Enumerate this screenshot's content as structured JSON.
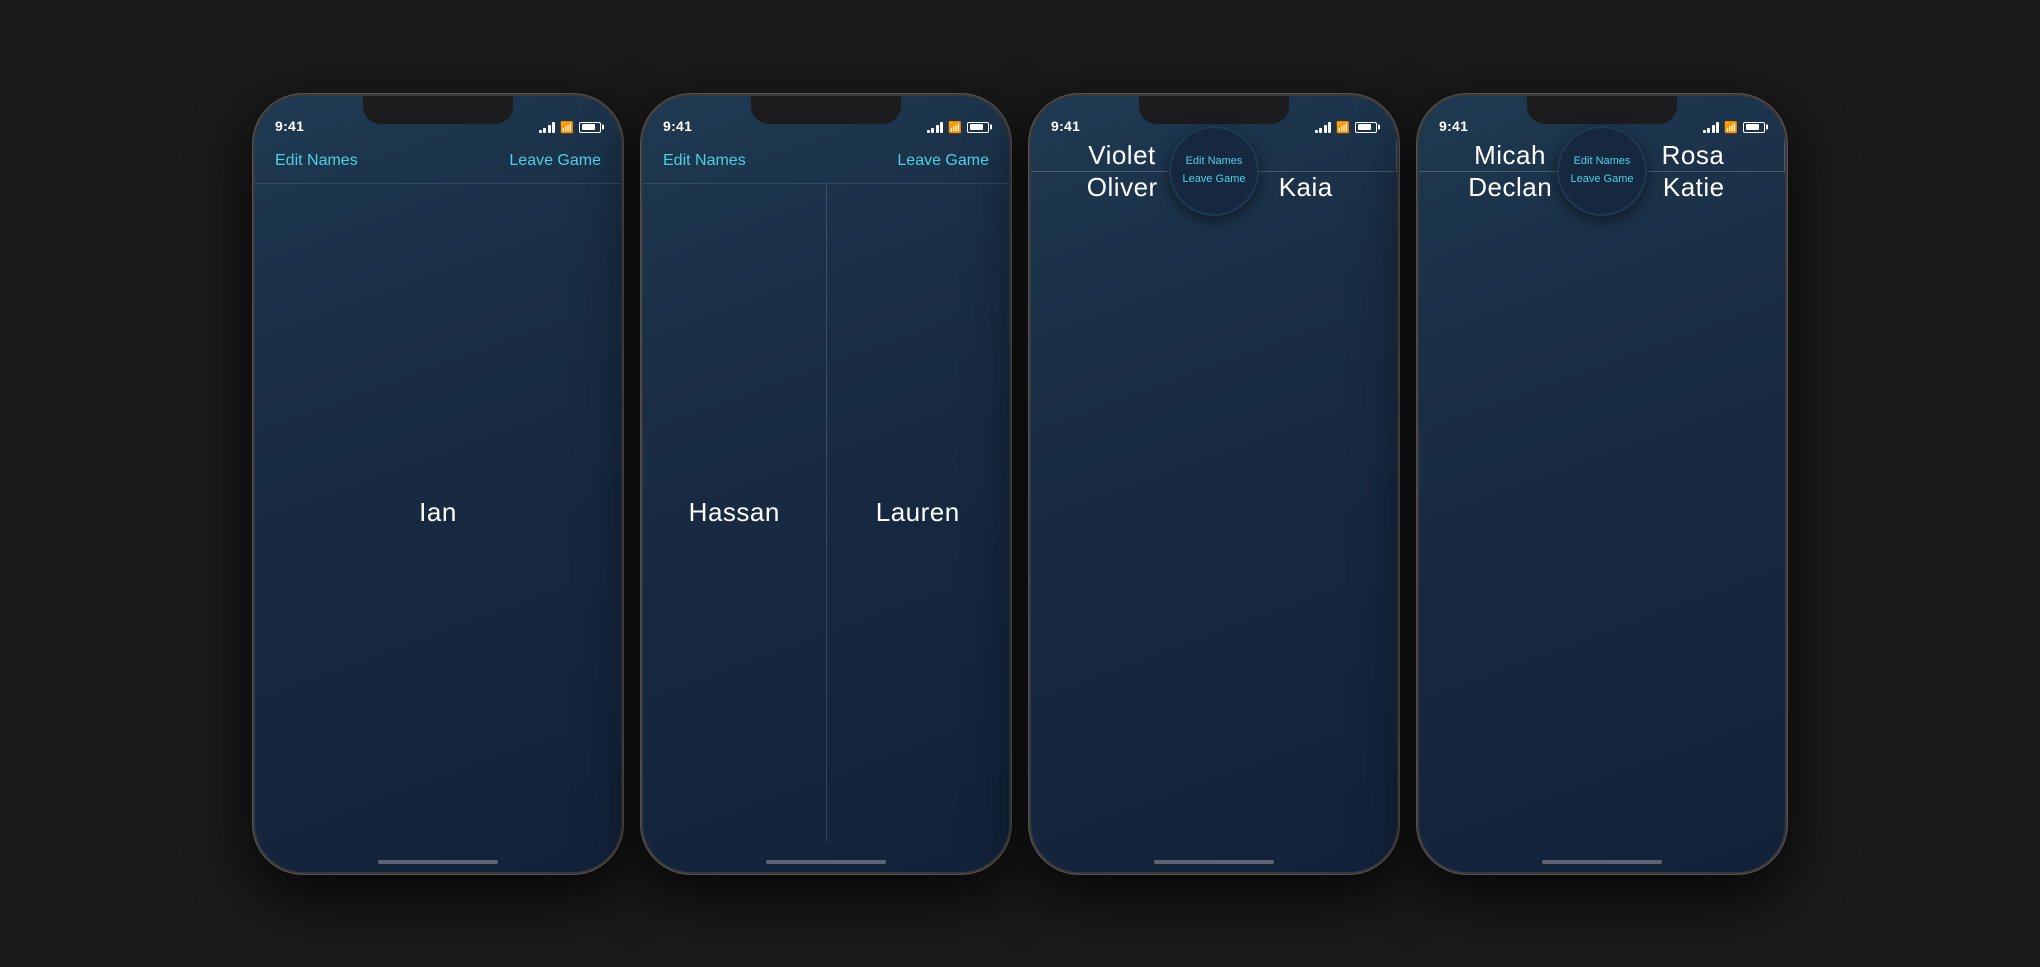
{
  "phones": [
    {
      "id": "phone-1",
      "time": "9:41",
      "layout": "1",
      "nav": {
        "edit": "Edit Names",
        "leave": "Leave Game"
      },
      "players": [
        {
          "name": "Ian"
        }
      ]
    },
    {
      "id": "phone-2",
      "time": "9:41",
      "layout": "2",
      "nav": {
        "edit": "Edit Names",
        "leave": "Leave Game"
      },
      "players": [
        {
          "name": "Hassan"
        },
        {
          "name": "Lauren"
        }
      ]
    },
    {
      "id": "phone-3",
      "time": "9:41",
      "layout": "4",
      "nav": null,
      "center_menu": {
        "edit": "Edit Names",
        "leave": "Leave Game"
      },
      "players": [
        {
          "name": "Violet"
        },
        {
          "name": ""
        },
        {
          "name": "Oliver"
        },
        {
          "name": "Kaia"
        }
      ]
    },
    {
      "id": "phone-4",
      "time": "9:41",
      "layout": "4",
      "nav": null,
      "center_menu": {
        "edit": "Edit Names",
        "leave": "Leave Game"
      },
      "players": [
        {
          "name": "Micah"
        },
        {
          "name": "Rosa"
        },
        {
          "name": "Declan"
        },
        {
          "name": "Katie"
        }
      ]
    }
  ]
}
